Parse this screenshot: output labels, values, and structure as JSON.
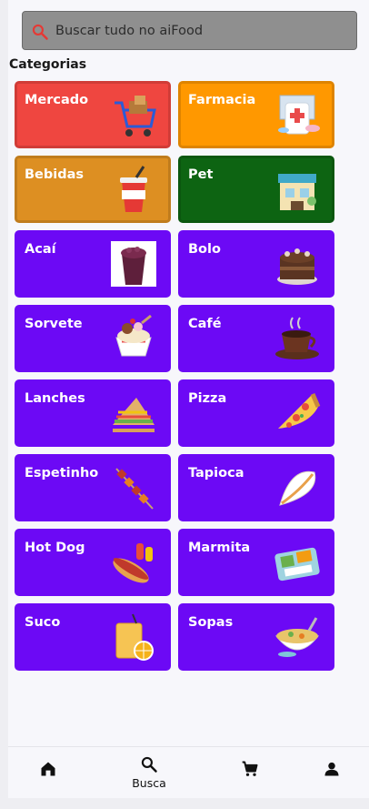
{
  "search": {
    "placeholder": "Buscar tudo no aiFood",
    "value": "",
    "icon": "search-icon",
    "icon_color": "#e53935"
  },
  "section_title": "Categorias",
  "categories": [
    {
      "label": "Mercado",
      "color": "#ef4640",
      "icon": "shopping-cart-icon"
    },
    {
      "label": "Farmacia",
      "color": "#ff9800",
      "icon": "pharmacy-icon"
    },
    {
      "label": "Bebidas",
      "color": "#dd8f22",
      "icon": "drink-cup-icon"
    },
    {
      "label": "Pet",
      "color": "#0d6412",
      "icon": "pet-shop-icon"
    },
    {
      "label": "Acaí",
      "color": "#6c09f5",
      "icon": "acai-cup-icon"
    },
    {
      "label": "Bolo",
      "color": "#6c09f5",
      "icon": "cake-icon"
    },
    {
      "label": "Sorvete",
      "color": "#6c09f5",
      "icon": "ice-cream-icon"
    },
    {
      "label": "Café",
      "color": "#6c09f5",
      "icon": "coffee-cup-icon"
    },
    {
      "label": "Lanches",
      "color": "#6c09f5",
      "icon": "sandwich-icon"
    },
    {
      "label": "Pizza",
      "color": "#6c09f5",
      "icon": "pizza-slice-icon"
    },
    {
      "label": "Espetinho",
      "color": "#6c09f5",
      "icon": "skewer-icon"
    },
    {
      "label": "Tapioca",
      "color": "#6c09f5",
      "icon": "tapioca-icon"
    },
    {
      "label": "Hot Dog",
      "color": "#6c09f5",
      "icon": "hot-dog-icon"
    },
    {
      "label": "Marmita",
      "color": "#6c09f5",
      "icon": "lunchbox-icon"
    },
    {
      "label": "Suco",
      "color": "#6c09f5",
      "icon": "juice-glass-icon"
    },
    {
      "label": "Sopas",
      "color": "#6c09f5",
      "icon": "soup-bowl-icon"
    }
  ],
  "bottom_nav": [
    {
      "label": "",
      "icon": "home-icon",
      "active": false
    },
    {
      "label": "Busca",
      "icon": "search-icon",
      "active": true
    },
    {
      "label": "",
      "icon": "cart-icon",
      "active": false
    },
    {
      "label": "",
      "icon": "person-icon",
      "active": false
    }
  ]
}
